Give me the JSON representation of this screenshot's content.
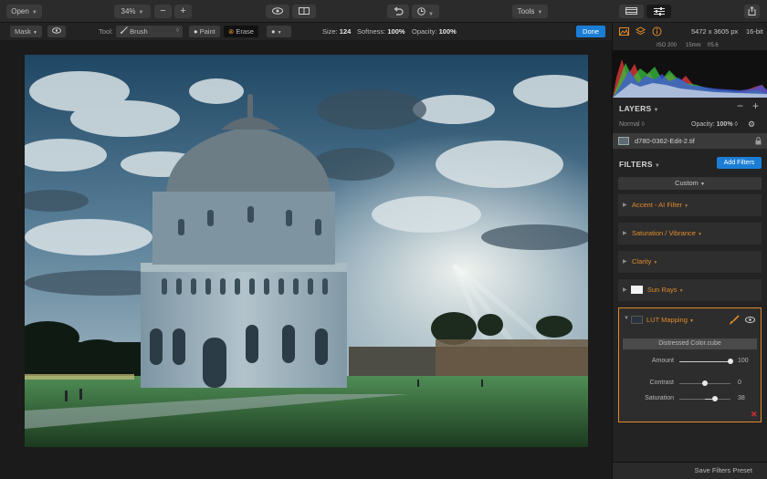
{
  "toolbar": {
    "open_label": "Open",
    "zoom_label": "34%",
    "zoom_out": "−",
    "zoom_in": "+",
    "tools_label": "Tools"
  },
  "toolbar2": {
    "mask_label": "Mask",
    "tool_label": "Tool:",
    "brush_label": "Brush",
    "brush_arrows": "◊",
    "paint_label": "Paint",
    "erase_label": "Erase",
    "size_label": "Size:",
    "size_value": "124",
    "softness_label": "Softness:",
    "softness_value": "100%",
    "opacity_label": "Opacity:",
    "opacity_value": "100%",
    "done_label": "Done"
  },
  "image_info": {
    "dimensions": "5472 x 3605 px",
    "bit_depth": "16-bit",
    "iso": "ISO 200",
    "focal": "15mm",
    "aperture": "f/5.6"
  },
  "layers": {
    "title": "LAYERS",
    "minus": "−",
    "plus": "+",
    "blend_mode": "Normal",
    "opacity_label": "Opacity:",
    "opacity_value": "100%",
    "layer_name": "d780-0362-Edit-2.tif"
  },
  "filters": {
    "title": "FILTERS",
    "add_label": "Add Filters",
    "custom_label": "Custom",
    "items": [
      {
        "name": "Accent - AI Filter"
      },
      {
        "name": "Saturation / Vibrance"
      },
      {
        "name": "Clarity"
      },
      {
        "name": "Sun Rays"
      }
    ],
    "lut": {
      "name": "LUT Mapping",
      "preset": "Distressed Color.cube",
      "params": [
        {
          "label": "Amount",
          "value": "100",
          "level": 1.0
        },
        {
          "label": "Contrast",
          "value": "0",
          "level": 0.5
        },
        {
          "label": "Saturation",
          "value": "38",
          "level": 0.69
        }
      ]
    },
    "save_label": "Save Filters Preset"
  },
  "colors": {
    "accent": "#1b7ed6",
    "filter_orange": "#e08a2b",
    "remove_red": "#e03030"
  }
}
